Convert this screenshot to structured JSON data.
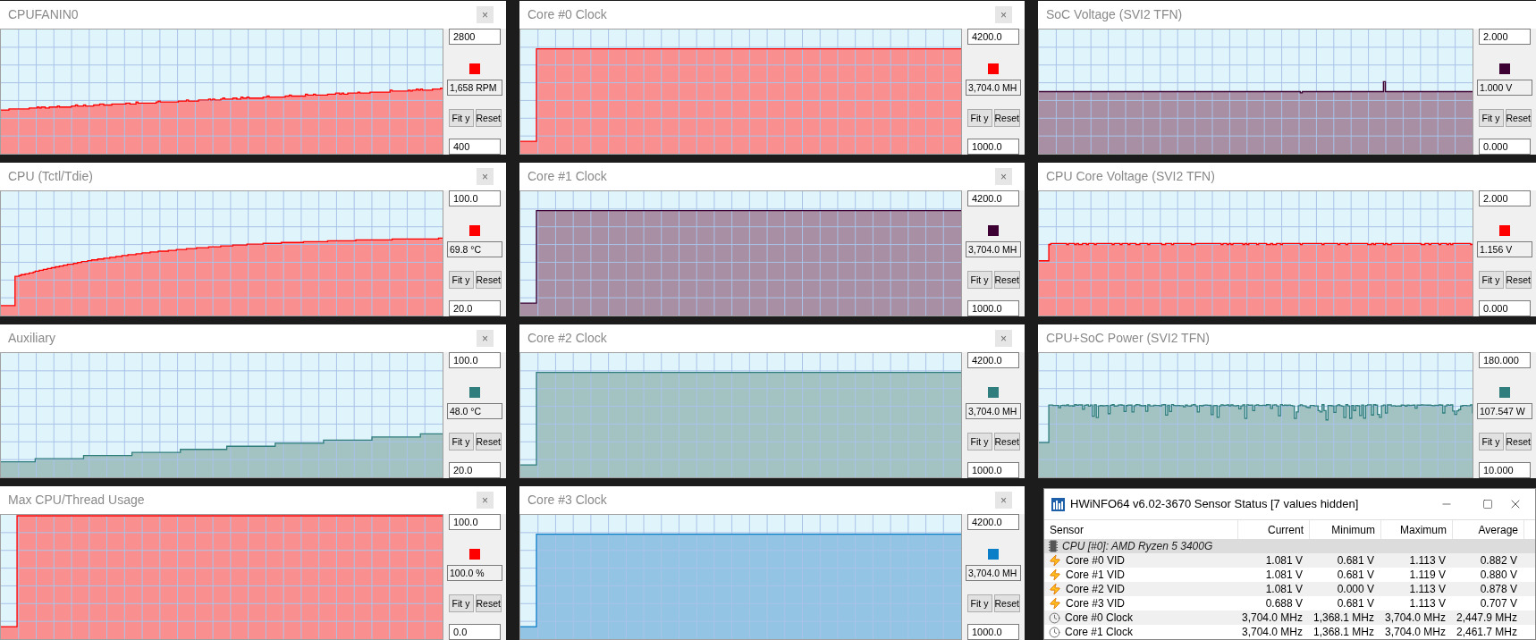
{
  "graph_windows": [
    {
      "title": "CPUFANIN0",
      "close_label": "×",
      "kind": "ramp",
      "color": "#ff0000",
      "max_value": "2800",
      "current_value": "1,658 RPM",
      "min_value": "400",
      "fit_label": "Fit y",
      "reset_label": "Reset"
    },
    {
      "title": "Core #0 Clock",
      "close_label": "×",
      "kind": "step",
      "color": "#ff0000",
      "max_value": "4200.0",
      "current_value": "3,704.0 MH",
      "min_value": "1000.0",
      "fit_label": "Fit y",
      "reset_label": "Reset"
    },
    {
      "title": "SoC Voltage (SVI2 TFN)",
      "kind": "flat",
      "color": "#3c0033",
      "max_value": "2.000",
      "current_value": "1.000 V",
      "min_value": "0.000",
      "fit_label": "Fit y",
      "reset_label": "Reset"
    },
    {
      "title": "CPU (Tctl/Tdie)",
      "close_label": "×",
      "kind": "log",
      "color": "#ff0000",
      "max_value": "100.0",
      "current_value": "69.8 °C",
      "min_value": "20.0",
      "fit_label": "Fit y",
      "reset_label": "Reset"
    },
    {
      "title": "Core #1 Clock",
      "close_label": "×",
      "kind": "step",
      "color": "#3c0033",
      "max_value": "4200.0",
      "current_value": "3,704.0 MH",
      "min_value": "1000.0",
      "fit_label": "Fit y",
      "reset_label": "Reset"
    },
    {
      "title": "CPU Core Voltage (SVI2 TFN)",
      "kind": "jump",
      "color": "#ff0000",
      "max_value": "2.000",
      "current_value": "1.156 V",
      "min_value": "0.000",
      "fit_label": "Fit y",
      "reset_label": "Reset"
    },
    {
      "title": "Auxiliary",
      "close_label": "×",
      "kind": "stairs",
      "color": "#2f7d7d",
      "max_value": "100.0",
      "current_value": "48.0 °C",
      "min_value": "20.0",
      "fit_label": "Fit y",
      "reset_label": "Reset"
    },
    {
      "title": "Core #2 Clock",
      "close_label": "×",
      "kind": "step",
      "color": "#2f7d7d",
      "max_value": "4200.0",
      "current_value": "3,704.0 MH",
      "min_value": "1000.0",
      "fit_label": "Fit y",
      "reset_label": "Reset"
    },
    {
      "title": "CPU+SoC Power (SVI2 TFN)",
      "kind": "noisy",
      "color": "#2f7d7d",
      "max_value": "180.000",
      "current_value": "107.547 W",
      "min_value": "10.000",
      "fit_label": "Fit y",
      "reset_label": "Reset"
    },
    {
      "title": "Max CPU/Thread Usage",
      "close_label": "×",
      "kind": "full",
      "color": "#ff0000",
      "max_value": "100.0",
      "current_value": "100.0 %",
      "min_value": "0.0",
      "fit_label": "Fit y",
      "reset_label": "Reset"
    },
    {
      "title": "Core #3 Clock",
      "close_label": "×",
      "kind": "step",
      "color": "#0a7fc8",
      "max_value": "4200.0",
      "current_value": "3,704.0 MH",
      "min_value": "1000.0",
      "fit_label": "Fit y",
      "reset_label": "Reset"
    }
  ],
  "sensor_window": {
    "title": "HWiNFO64 v6.02-3670 Sensor Status [7 values hidden]",
    "columns": [
      "Sensor",
      "Current",
      "Minimum",
      "Maximum",
      "Average"
    ],
    "rows": [
      {
        "kind": "group",
        "sensor": "CPU [#0]: AMD Ryzen 5 3400G"
      },
      {
        "kind": "voltage",
        "sensor": "Core #0 VID",
        "current": "1.081 V",
        "minimum": "0.681 V",
        "maximum": "1.113 V",
        "average": "0.882 V"
      },
      {
        "kind": "voltage",
        "sensor": "Core #1 VID",
        "current": "1.081 V",
        "minimum": "0.681 V",
        "maximum": "1.119 V",
        "average": "0.880 V"
      },
      {
        "kind": "voltage",
        "sensor": "Core #2 VID",
        "current": "1.081 V",
        "minimum": "0.000 V",
        "maximum": "1.113 V",
        "average": "0.878 V"
      },
      {
        "kind": "voltage",
        "sensor": "Core #3 VID",
        "current": "0.688 V",
        "minimum": "0.681 V",
        "maximum": "1.113 V",
        "average": "0.707 V"
      },
      {
        "kind": "clock",
        "sensor": "Core #0 Clock",
        "current": "3,704.0 MHz",
        "minimum": "1,368.1 MHz",
        "maximum": "3,704.0 MHz",
        "average": "2,447.9 MHz"
      },
      {
        "kind": "clock",
        "sensor": "Core #1 Clock",
        "current": "3,704.0 MHz",
        "minimum": "1,368.1 MHz",
        "maximum": "3,704.0 MHz",
        "average": "2,461.7 MHz"
      }
    ]
  }
}
